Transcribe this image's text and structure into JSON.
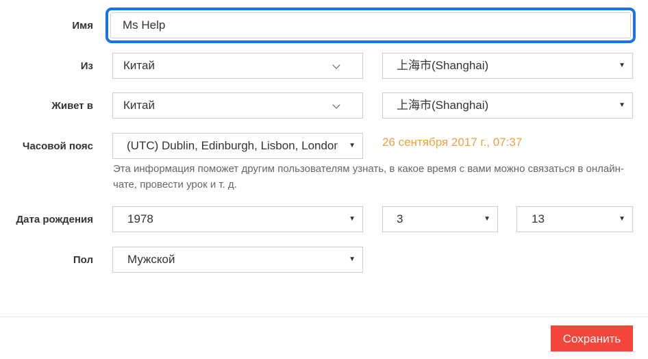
{
  "form": {
    "name": {
      "label": "Имя",
      "value": "Ms Help"
    },
    "from": {
      "label": "Из",
      "country": "Китай",
      "city": "上海市(Shanghai)"
    },
    "lives_in": {
      "label": "Живет в",
      "country": "Китай",
      "city": "上海市(Shanghai)"
    },
    "timezone": {
      "label": "Часовой пояс",
      "value": "(UTC) Dublin, Edinburgh, Lisbon, London",
      "current_time": "26 сентября 2017 г., 07:37",
      "hint": "Эта информация поможет другим пользователям узнать, в какое время с вами можно связаться в онлайн-чате, провести урок и т. д."
    },
    "birthdate": {
      "label": "Дата рождения",
      "year": "1978",
      "month": "3",
      "day": "13"
    },
    "gender": {
      "label": "Пол",
      "value": "Мужской"
    }
  },
  "footer": {
    "save_label": "Сохранить"
  },
  "icons": {
    "dropdown_caret": "caret-down-icon",
    "chevron": "chevron-down-icon"
  },
  "colors": {
    "focus": "#1a73e8",
    "accent_time": "#f0a040",
    "save_button": "#f4463a"
  }
}
